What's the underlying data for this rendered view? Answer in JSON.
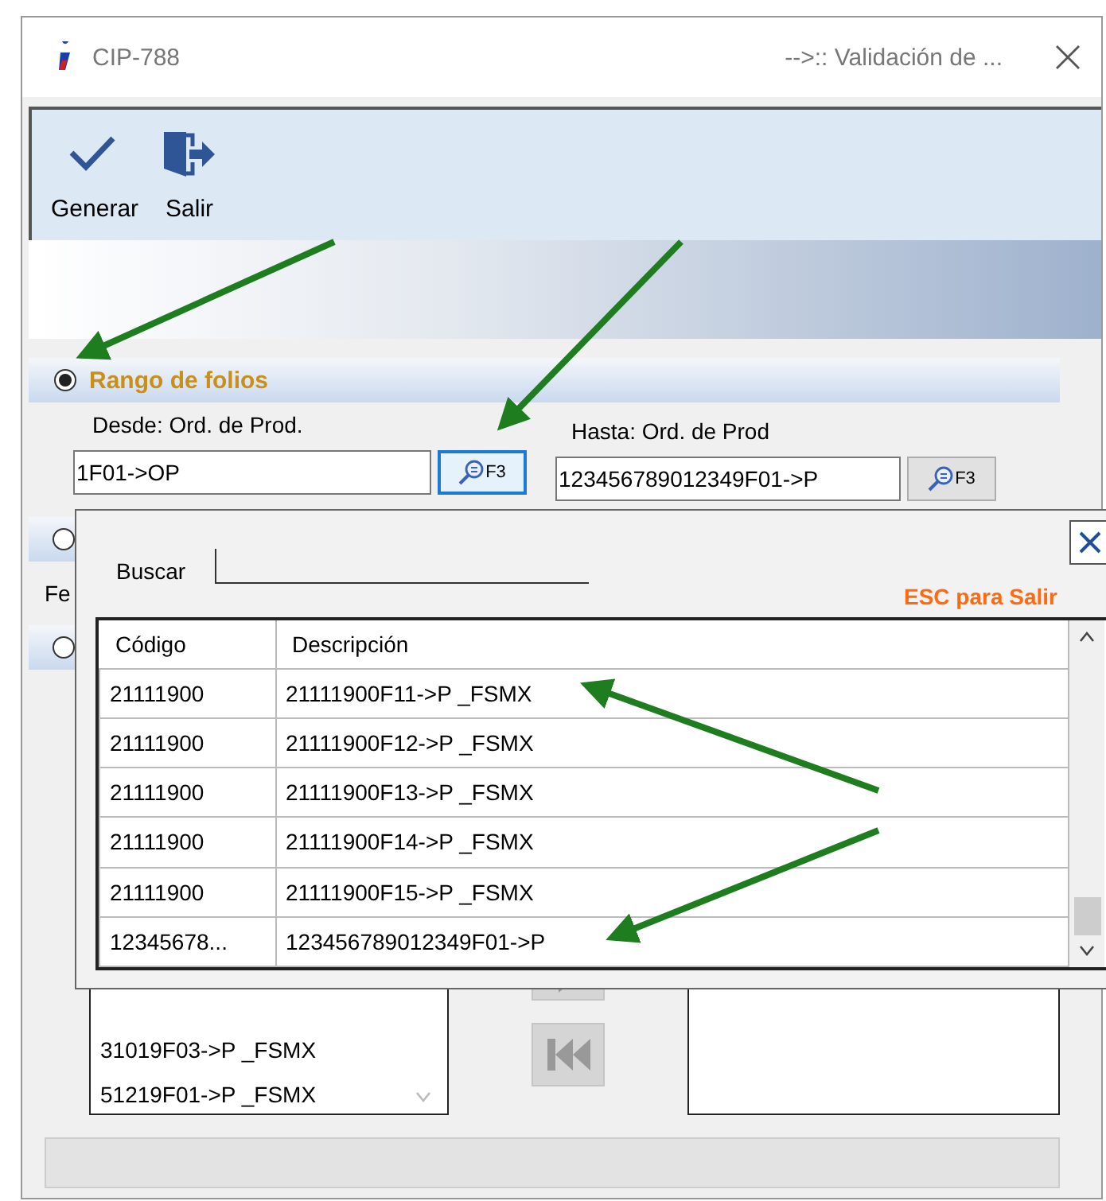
{
  "window": {
    "title": "CIP-788",
    "subtitle": "-->:: Validación de ..."
  },
  "toolbar": [
    {
      "label": "Generar",
      "kind": "check"
    },
    {
      "label": "Salir",
      "kind": "exit"
    }
  ],
  "range_section": {
    "title": "Rango de folios",
    "selected": true,
    "from": {
      "label": "Desde: Ord. de Prod.",
      "value": "1F01->OP",
      "button": "F3",
      "focused": true
    },
    "to": {
      "label": "Hasta: Ord. de Prod",
      "value": "123456789012349F01->P",
      "button": "F3",
      "focused": false
    }
  },
  "other_sections": [
    {
      "selected": false
    },
    {
      "selected": false
    }
  ],
  "partial_label": "Fe",
  "left_list": {
    "items": [
      "31019F03->P _FSMX",
      "51219F01->P _FSMX"
    ]
  },
  "lookup": {
    "search_label": "Buscar",
    "hint": "ESC para Salir",
    "columns": [
      "Código",
      "Descripción"
    ],
    "rows": [
      [
        "21111900",
        "21111900F11->P _FSMX"
      ],
      [
        "21111900",
        "21111900F12->P _FSMX"
      ],
      [
        "21111900",
        "21111900F13->P _FSMX"
      ],
      [
        "21111900",
        "21111900F14->P _FSMX"
      ],
      [
        "21111900",
        "21111900F15->P _FSMX"
      ],
      [
        "12345678...",
        "123456789012349F01->P"
      ]
    ]
  }
}
